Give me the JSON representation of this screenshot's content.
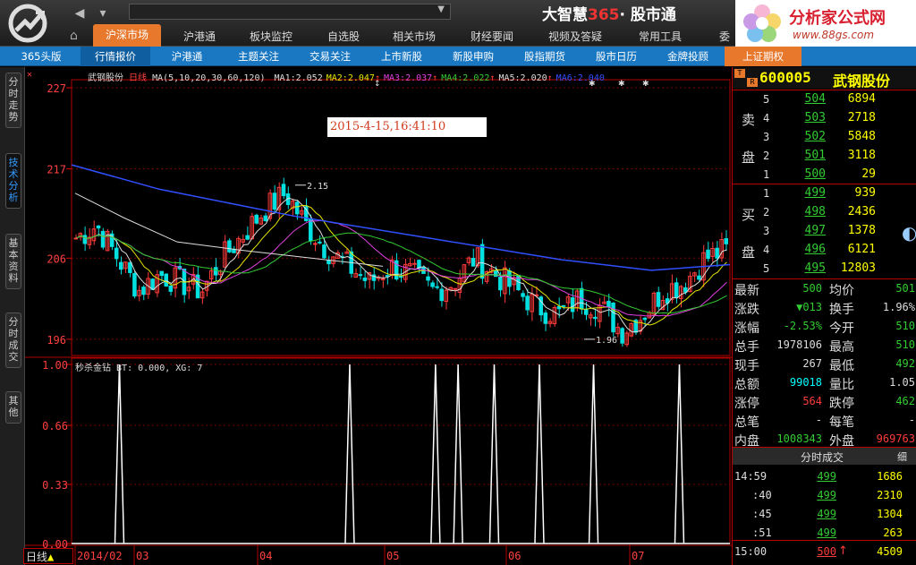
{
  "topbar": {
    "brand_name": "大智慧",
    "brand_num": "365",
    "brand_dot": "·",
    "brand_tail": "股市通",
    "main_tabs": [
      "沪深市场",
      "沪港通",
      "板块监控",
      "自选股",
      "相关市场",
      "财经要闻",
      "视频及答疑",
      "常用工具",
      "委"
    ],
    "ad_title": "分析家公式网",
    "ad_url": "www.88gs.com"
  },
  "subbar": {
    "tabs": [
      "365头版",
      "行情报价",
      "沪港通",
      "主题关注",
      "交易关注",
      "上市新股",
      "新股申购",
      "股指期货",
      "股市日历",
      "金牌投顾",
      "上证期权"
    ]
  },
  "side_tabs": [
    "分时走势",
    "技术分析",
    "基本资料",
    "分时成交",
    "其他"
  ],
  "chart": {
    "stock_name": "武钢股份",
    "period": "日线",
    "ma_params": "MA(5,10,20,30,60,120)",
    "ma_values": [
      {
        "label": "MA1:",
        "value": "2.052",
        "arrow": "",
        "color": "#dddddd"
      },
      {
        "label": "MA2:",
        "value": "2.047",
        "arrow": "↑",
        "color": "#e6e600"
      },
      {
        "label": "MA3:",
        "value": "2.037",
        "arrow": "↑",
        "color": "#e040e0"
      },
      {
        "label": "MA4:",
        "value": "2.022",
        "arrow": "↑",
        "color": "#33cc33"
      },
      {
        "label": "MA5:",
        "value": "2.020",
        "arrow": "↑",
        "color": "#dddddd"
      },
      {
        "label": "MA6:",
        "value": "2.040",
        "arrow": "",
        "color": "#3050ff"
      }
    ],
    "datetime": "2015-4-15,16:41:10",
    "price_ticks": [
      "227",
      "217",
      "206",
      "196"
    ],
    "high_label": "2.15",
    "low_label": "1.96",
    "indicator_name": "秒杀金钻",
    "indicator_values": "BT: 0.000, XG: 7",
    "ind_ticks": [
      "1.00",
      "0.66",
      "0.33",
      "0.00"
    ],
    "period_footer": "日线",
    "x_labels": [
      "2014/02",
      "03",
      "04",
      "05",
      "06",
      "07"
    ]
  },
  "chart_data": {
    "type": "line",
    "title": "武钢股份 日线",
    "series": [
      {
        "name": "秒杀金钻 XG",
        "x": [
          10,
          61,
          80,
          85,
          93,
          103,
          115,
          134
        ],
        "values": [
          1,
          1,
          1,
          1,
          1,
          1,
          1,
          1
        ]
      }
    ],
    "ylim": [
      0,
      1
    ],
    "ytick_labels": [
      "1.00",
      "0.66",
      "0.33",
      "0.00"
    ],
    "price_ylim": [
      1.94,
      2.28
    ],
    "price_ytick_labels": [
      "227",
      "217",
      "206",
      "196"
    ],
    "xtick_labels": [
      "2014/02",
      "03",
      "04",
      "05",
      "06",
      "07"
    ],
    "annotations": [
      "2.15",
      "1.96"
    ]
  },
  "quote": {
    "tag": "T",
    "tag2": "R",
    "code": "600005",
    "name": "武钢股份",
    "sell_label": [
      "卖",
      "盘"
    ],
    "buy_label": [
      "买",
      "盘"
    ],
    "asks": [
      {
        "n": "5",
        "p": "504",
        "v": "6894"
      },
      {
        "n": "4",
        "p": "503",
        "v": "2718"
      },
      {
        "n": "3",
        "p": "502",
        "v": "5848"
      },
      {
        "n": "2",
        "p": "501",
        "v": "3118"
      },
      {
        "n": "1",
        "p": "500",
        "v": "29"
      }
    ],
    "bids": [
      {
        "n": "1",
        "p": "499",
        "v": "939"
      },
      {
        "n": "2",
        "p": "498",
        "v": "2436"
      },
      {
        "n": "3",
        "p": "497",
        "v": "1378"
      },
      {
        "n": "4",
        "p": "496",
        "v": "6121"
      },
      {
        "n": "5",
        "p": "495",
        "v": "12803"
      }
    ],
    "stats": [
      {
        "l1": "最新",
        "v1": "500",
        "c1": "grn",
        "l2": "均价",
        "v2": "501",
        "c2": "grn"
      },
      {
        "l1": "涨跌",
        "v1": "▼013",
        "c1": "grn",
        "l2": "换手",
        "v2": "1.96%",
        "c2": "wht"
      },
      {
        "l1": "涨幅",
        "v1": "-2.53%",
        "c1": "grn",
        "l2": "今开",
        "v2": "510",
        "c2": "grn"
      },
      {
        "l1": "总手",
        "v1": "1978106",
        "c1": "wht",
        "l2": "最高",
        "v2": "510",
        "c2": "grn"
      },
      {
        "l1": "现手",
        "v1": "267",
        "c1": "wht",
        "l2": "最低",
        "v2": "492",
        "c2": "grn"
      },
      {
        "l1": "总额",
        "v1": "99018",
        "c1": "cyn",
        "l2": "量比",
        "v2": "1.05",
        "c2": "wht"
      },
      {
        "l1": "涨停",
        "v1": "564",
        "c1": "red",
        "l2": "跌停",
        "v2": "462",
        "c2": "grn"
      },
      {
        "l1": "总笔",
        "v1": "-",
        "c1": "wht",
        "l2": "每笔",
        "v2": "-",
        "c2": "wht"
      },
      {
        "l1": "内盘",
        "v1": "1008343",
        "c1": "grn",
        "l2": "外盘",
        "v2": "969763",
        "c2": "red"
      }
    ],
    "trades_title": "分时成交",
    "trades_btn": "细",
    "trades": [
      {
        "t": "14:59",
        "p": "499",
        "v": "1686"
      },
      {
        "t": ":40",
        "p": "499",
        "v": "2310"
      },
      {
        "t": ":45",
        "p": "499",
        "v": "1304"
      },
      {
        "t": ":51",
        "p": "499",
        "v": "263"
      },
      {
        "t": "15:00",
        "p": "500",
        "arrow": "↑",
        "v": "4509"
      }
    ]
  },
  "colors": {
    "accent": "#e8782c",
    "bar": "#1a78c2",
    "up": "#ff3b3b",
    "down": "#00e0e0",
    "grid": "#b00000"
  }
}
